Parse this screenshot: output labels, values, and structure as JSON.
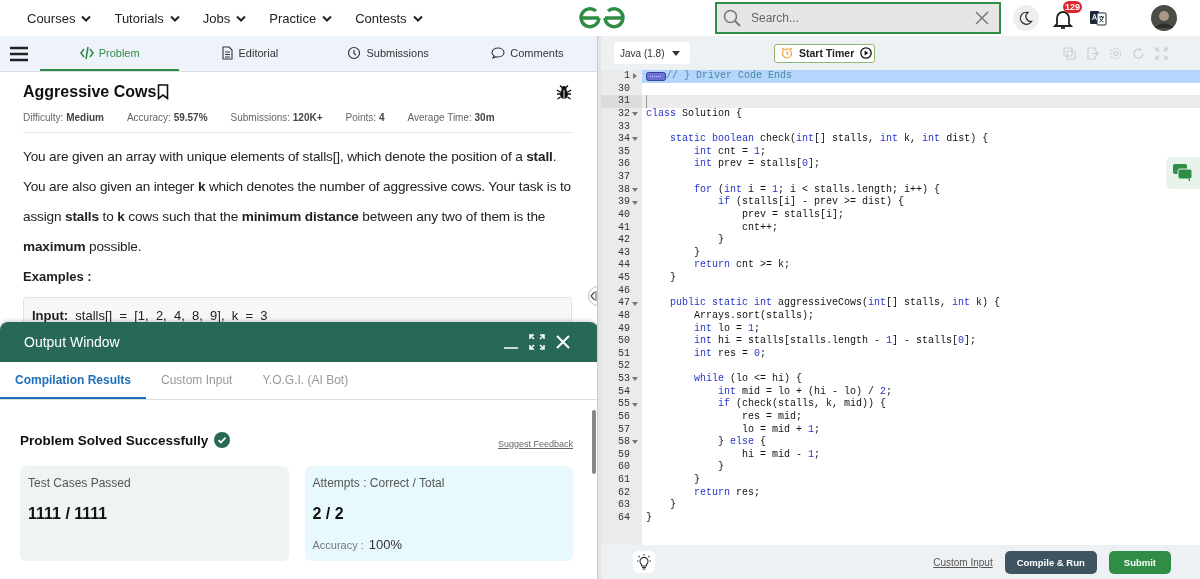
{
  "nav": {
    "items": [
      {
        "label": "Courses"
      },
      {
        "label": "Tutorials"
      },
      {
        "label": "Jobs"
      },
      {
        "label": "Practice"
      },
      {
        "label": "Contests"
      }
    ],
    "search": {
      "placeholder": "Search..."
    },
    "notification_count": "129"
  },
  "problem_tabs": [
    {
      "label": "Problem",
      "selected": true
    },
    {
      "label": "Editorial",
      "selected": false
    },
    {
      "label": "Submissions",
      "selected": false
    },
    {
      "label": "Comments",
      "selected": false
    }
  ],
  "problem": {
    "title": "Aggressive Cows",
    "meta": [
      "Difficulty: **Medium**",
      "Accuracy: **59.57%**",
      "Submissions: **120K+**",
      "Points: **4**",
      "Average Time: **30m**"
    ],
    "description": "You are given an array with unique elements of stalls[], which denote the position of a **stall**. You are also given an integer **k** which denotes the number of aggressive cows. Your task is to assign **stalls** to **k** cows such that the **minimum distance** between any two of them is the **maximum** possible.",
    "examples_heading": "Examples :",
    "example_input": "**Input:**  stalls[]  =  [1,  2,  4,  8,  9],  k  =  3"
  },
  "output_window": {
    "title": "Output Window",
    "tabs": [
      {
        "label": "Compilation Results",
        "selected": true
      },
      {
        "label": "Custom Input",
        "selected": false
      },
      {
        "label": "Y.O.G.I. (AI Bot)",
        "selected": false
      }
    ],
    "status": "Problem Solved Successfully",
    "feedback_link": "Suggest Feedback",
    "cards": [
      {
        "label": "Test Cases Passed",
        "value": "1111 / 1111"
      },
      {
        "label": "Attempts : Correct / Total",
        "value": "2 / 2",
        "note_label": "Accuracy :",
        "note_value": "100%"
      }
    ]
  },
  "editor": {
    "language": "Java (1.8)",
    "timer_button": "Start Timer",
    "lines": [
      {
        "number": "1",
        "folded": true,
        "selected": true,
        "cursor": false,
        "tokens": [
          {
            "kind": "comment",
            "text": "// } Driver Code Ends"
          }
        ]
      },
      {
        "number": "30",
        "selected": false,
        "cursor": false
      },
      {
        "number": "31",
        "selected": false,
        "cursor": true
      },
      {
        "number": "32",
        "folded": false,
        "selected": false,
        "cursor": false,
        "tokens": [
          {
            "kind": "keyword",
            "text": "class"
          },
          {
            "kind": "plain",
            "text": " Solution {"
          }
        ]
      },
      {
        "number": "33",
        "selected": false,
        "cursor": false
      },
      {
        "number": "34",
        "folded": false,
        "selected": false,
        "cursor": false,
        "tokens": [
          {
            "kind": "keyword",
            "text": "    static boolean"
          },
          {
            "kind": "plain",
            "text": " check("
          },
          {
            "kind": "keyword",
            "text": "int"
          },
          {
            "kind": "plain",
            "text": "[] stalls, "
          },
          {
            "kind": "keyword",
            "text": "int"
          },
          {
            "kind": "plain",
            "text": " k, "
          },
          {
            "kind": "keyword",
            "text": "int"
          },
          {
            "kind": "plain",
            "text": " dist) {"
          }
        ]
      },
      {
        "number": "35",
        "selected": false,
        "cursor": false,
        "tokens": [
          {
            "kind": "keyword",
            "text": "        int"
          },
          {
            "kind": "plain",
            "text": " cnt = "
          },
          {
            "kind": "number",
            "text": "1"
          },
          {
            "kind": "plain",
            "text": ";"
          }
        ]
      },
      {
        "number": "36",
        "selected": false,
        "cursor": false,
        "tokens": [
          {
            "kind": "keyword",
            "text": "        int"
          },
          {
            "kind": "plain",
            "text": " prev = stalls["
          },
          {
            "kind": "number",
            "text": "0"
          },
          {
            "kind": "plain",
            "text": "];"
          }
        ]
      },
      {
        "number": "37",
        "selected": false,
        "cursor": false
      },
      {
        "number": "38",
        "folded": false,
        "selected": false,
        "cursor": false,
        "tokens": [
          {
            "kind": "keyword",
            "text": "        for"
          },
          {
            "kind": "plain",
            "text": " ("
          },
          {
            "kind": "keyword",
            "text": "int"
          },
          {
            "kind": "plain",
            "text": " i = "
          },
          {
            "kind": "number",
            "text": "1"
          },
          {
            "kind": "plain",
            "text": "; i < stalls.length; i++) {"
          }
        ]
      },
      {
        "number": "39",
        "folded": false,
        "selected": false,
        "cursor": false,
        "tokens": [
          {
            "kind": "keyword",
            "text": "            if"
          },
          {
            "kind": "plain",
            "text": " (stalls[i] - prev >= dist) {"
          }
        ]
      },
      {
        "number": "40",
        "selected": false,
        "cursor": false,
        "tokens": [
          {
            "kind": "plain",
            "text": "                prev = stalls[i];"
          }
        ]
      },
      {
        "number": "41",
        "selected": false,
        "cursor": false,
        "tokens": [
          {
            "kind": "plain",
            "text": "                cnt++;"
          }
        ]
      },
      {
        "number": "42",
        "selected": false,
        "cursor": false,
        "tokens": [
          {
            "kind": "plain",
            "text": "            }"
          }
        ]
      },
      {
        "number": "43",
        "selected": false,
        "cursor": false,
        "tokens": [
          {
            "kind": "plain",
            "text": "        }"
          }
        ]
      },
      {
        "number": "44",
        "selected": false,
        "cursor": false,
        "tokens": [
          {
            "kind": "keyword",
            "text": "        return"
          },
          {
            "kind": "plain",
            "text": " cnt >= k;"
          }
        ]
      },
      {
        "number": "45",
        "selected": false,
        "cursor": false,
        "tokens": [
          {
            "kind": "plain",
            "text": "    }"
          }
        ]
      },
      {
        "number": "46",
        "selected": false,
        "cursor": false
      },
      {
        "number": "47",
        "folded": false,
        "selected": false,
        "cursor": false,
        "tokens": [
          {
            "kind": "keyword",
            "text": "    public static int"
          },
          {
            "kind": "plain",
            "text": " aggressiveCows("
          },
          {
            "kind": "keyword",
            "text": "int"
          },
          {
            "kind": "plain",
            "text": "[] stalls, "
          },
          {
            "kind": "keyword",
            "text": "int"
          },
          {
            "kind": "plain",
            "text": " k) {"
          }
        ]
      },
      {
        "number": "48",
        "selected": false,
        "cursor": false,
        "tokens": [
          {
            "kind": "plain",
            "text": "        Arrays.sort(stalls);"
          }
        ]
      },
      {
        "number": "49",
        "selected": false,
        "cursor": false,
        "tokens": [
          {
            "kind": "keyword",
            "text": "        int"
          },
          {
            "kind": "plain",
            "text": " lo = "
          },
          {
            "kind": "number",
            "text": "1"
          },
          {
            "kind": "plain",
            "text": ";"
          }
        ]
      },
      {
        "number": "50",
        "selected": false,
        "cursor": false,
        "tokens": [
          {
            "kind": "keyword",
            "text": "        int"
          },
          {
            "kind": "plain",
            "text": " hi = stalls[stalls.length - "
          },
          {
            "kind": "number",
            "text": "1"
          },
          {
            "kind": "plain",
            "text": "] - stalls["
          },
          {
            "kind": "number",
            "text": "0"
          },
          {
            "kind": "plain",
            "text": "];"
          }
        ]
      },
      {
        "number": "51",
        "selected": false,
        "cursor": false,
        "tokens": [
          {
            "kind": "keyword",
            "text": "        int"
          },
          {
            "kind": "plain",
            "text": " res = "
          },
          {
            "kind": "number",
            "text": "0"
          },
          {
            "kind": "plain",
            "text": ";"
          }
        ]
      },
      {
        "number": "52",
        "selected": false,
        "cursor": false
      },
      {
        "number": "53",
        "folded": false,
        "selected": false,
        "cursor": false,
        "tokens": [
          {
            "kind": "keyword",
            "text": "        while"
          },
          {
            "kind": "plain",
            "text": " (lo <= hi) {"
          }
        ]
      },
      {
        "number": "54",
        "selected": false,
        "cursor": false,
        "tokens": [
          {
            "kind": "keyword",
            "text": "            int"
          },
          {
            "kind": "plain",
            "text": " mid = lo + (hi - lo) / "
          },
          {
            "kind": "number",
            "text": "2"
          },
          {
            "kind": "plain",
            "text": ";"
          }
        ]
      },
      {
        "number": "55",
        "folded": false,
        "selected": false,
        "cursor": false,
        "tokens": [
          {
            "kind": "keyword",
            "text": "            if"
          },
          {
            "kind": "plain",
            "text": " (check(stalls, k, mid)) {"
          }
        ]
      },
      {
        "number": "56",
        "selected": false,
        "cursor": false,
        "tokens": [
          {
            "kind": "plain",
            "text": "                res = mid;"
          }
        ]
      },
      {
        "number": "57",
        "selected": false,
        "cursor": false,
        "tokens": [
          {
            "kind": "plain",
            "text": "                lo = mid + "
          },
          {
            "kind": "number",
            "text": "1"
          },
          {
            "kind": "plain",
            "text": ";"
          }
        ]
      },
      {
        "number": "58",
        "folded": false,
        "selected": false,
        "cursor": false,
        "tokens": [
          {
            "kind": "plain",
            "text": "            } "
          },
          {
            "kind": "keyword",
            "text": "else"
          },
          {
            "kind": "plain",
            "text": " {"
          }
        ]
      },
      {
        "number": "59",
        "selected": false,
        "cursor": false,
        "tokens": [
          {
            "kind": "plain",
            "text": "                hi = mid - "
          },
          {
            "kind": "number",
            "text": "1"
          },
          {
            "kind": "plain",
            "text": ";"
          }
        ]
      },
      {
        "number": "60",
        "selected": false,
        "cursor": false,
        "tokens": [
          {
            "kind": "plain",
            "text": "            }"
          }
        ]
      },
      {
        "number": "61",
        "selected": false,
        "cursor": false,
        "tokens": [
          {
            "kind": "plain",
            "text": "        }"
          }
        ]
      },
      {
        "number": "62",
        "selected": false,
        "cursor": false,
        "tokens": [
          {
            "kind": "keyword",
            "text": "        return"
          },
          {
            "kind": "plain",
            "text": " res;"
          }
        ]
      },
      {
        "number": "63",
        "selected": false,
        "cursor": false,
        "tokens": [
          {
            "kind": "plain",
            "text": "    }"
          }
        ]
      },
      {
        "number": "64",
        "selected": false,
        "cursor": false,
        "tokens": [
          {
            "kind": "plain",
            "text": "}"
          }
        ]
      }
    ]
  },
  "footer": {
    "custom_input": "Custom Input",
    "compile_button": "Compile & Run",
    "submit_button": "Submit"
  }
}
